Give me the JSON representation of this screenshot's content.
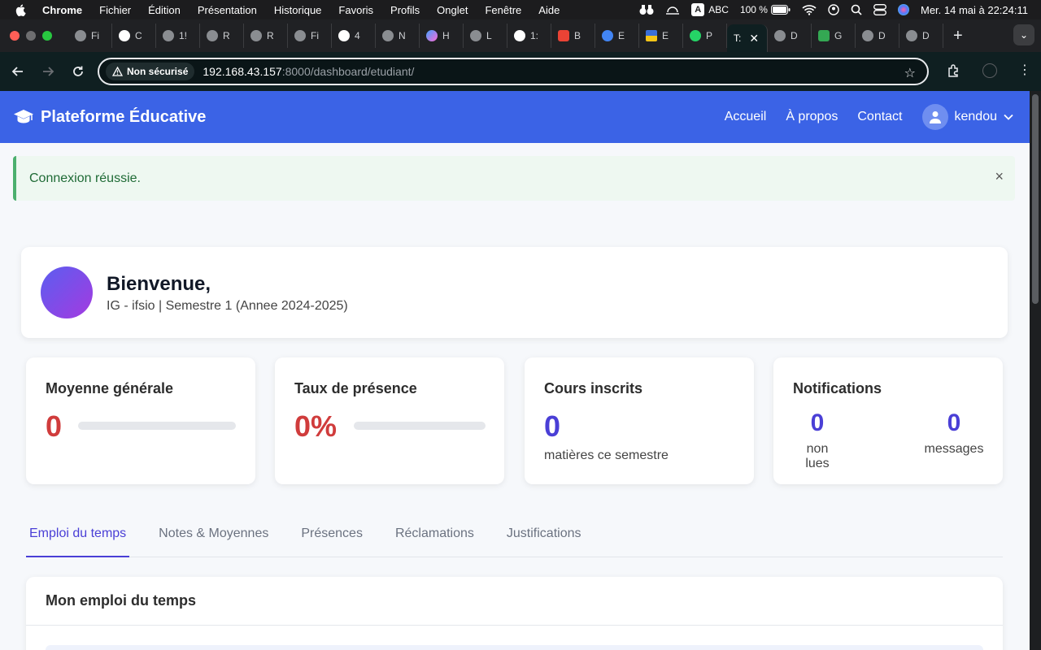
{
  "menubar": {
    "app": "Chrome",
    "items": [
      "Fichier",
      "Édition",
      "Présentation",
      "Historique",
      "Favoris",
      "Profils",
      "Onglet",
      "Fenêtre",
      "Aide"
    ],
    "input_method": "ABC",
    "battery": "100 %",
    "datetime": "Mer. 14 mai à  22:24:11"
  },
  "tabs": [
    {
      "label": "Fi"
    },
    {
      "label": "C"
    },
    {
      "label": "1!"
    },
    {
      "label": "R"
    },
    {
      "label": "R"
    },
    {
      "label": "Fi"
    },
    {
      "label": "4"
    },
    {
      "label": "N"
    },
    {
      "label": "H"
    },
    {
      "label": "L"
    },
    {
      "label": "1:"
    },
    {
      "label": "B"
    },
    {
      "label": "E"
    },
    {
      "label": "E"
    },
    {
      "label": "P"
    },
    {
      "label": "T:",
      "active": true
    },
    {
      "label": "D"
    },
    {
      "label": "G"
    },
    {
      "label": "D"
    },
    {
      "label": "D"
    }
  ],
  "address": {
    "security": "Non sécurisé",
    "host": "192.168.43.157",
    "path": ":8000/dashboard/etudiant/"
  },
  "navbar": {
    "brand": "Plateforme Éducative",
    "links": [
      "Accueil",
      "À propos",
      "Contact"
    ],
    "username": "kendou"
  },
  "alert": {
    "message": "Connexion réussie.",
    "close": "×"
  },
  "welcome": {
    "greeting": "Bienvenue,",
    "subtitle": "IG - ifsio | Semestre 1 (Annee 2024-2025)"
  },
  "stats": {
    "moyenne": {
      "title": "Moyenne générale",
      "value": "0",
      "progress": 0
    },
    "presence": {
      "title": "Taux de présence",
      "value": "0%",
      "progress": 0
    },
    "cours": {
      "title": "Cours inscrits",
      "value": "0",
      "caption": "matières ce semestre"
    },
    "notifications": {
      "title": "Notifications",
      "unread_value": "0",
      "unread_label": "non lues",
      "messages_value": "0",
      "messages_label": "messages"
    }
  },
  "section_tabs": [
    "Emploi du temps",
    "Notes & Moyennes",
    "Présences",
    "Réclamations",
    "Justifications"
  ],
  "panel": {
    "title": "Mon emploi du temps"
  },
  "colors": {
    "nav": "#3b63e6",
    "accent": "#4a3fd6",
    "danger": "#d03c3c",
    "success": "#4caf6e"
  }
}
